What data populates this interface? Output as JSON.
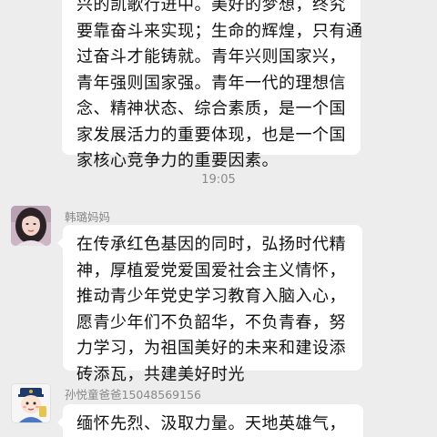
{
  "messages": [
    {
      "lines": [
        "兴的凯歌行进中。美好的梦想，终究",
        "要靠奋斗来实现；生命的辉煌，只有通",
        "过奋斗才能铸就。青年兴则国家兴，",
        "青年强则国家强。青年一代的理想信",
        "念、精神状态、综合素质，是一个国",
        "家发展活力的重要体现，也是一个国",
        "家核心竞争力的重要因素。"
      ]
    },
    {
      "sender": "韩璐妈妈",
      "lines": [
        "在传承红色基因的同时，弘扬时代精",
        "神，厚植爱党爱国爱社会主义情怀，",
        "推动青少年党史学习教育入脑入心，",
        "愿青少年们不负韶华，不负青春，努",
        "力学习，为祖国美好的未来和建设添",
        "砖添瓦，共建美好时光"
      ]
    },
    {
      "sender": "孙悦童爸爸15048569156",
      "lines": [
        "缅怀先烈、汲取力量。天地英雄气，"
      ]
    }
  ],
  "timestamp": "19:05",
  "icons": {
    "avatar1": "woman-portrait-avatar",
    "avatar2": "cartoon-child-avatar"
  },
  "colors": {
    "background": "#ededed",
    "bubble": "#ffffff",
    "text": "#111111",
    "meta_text": "#888888"
  }
}
